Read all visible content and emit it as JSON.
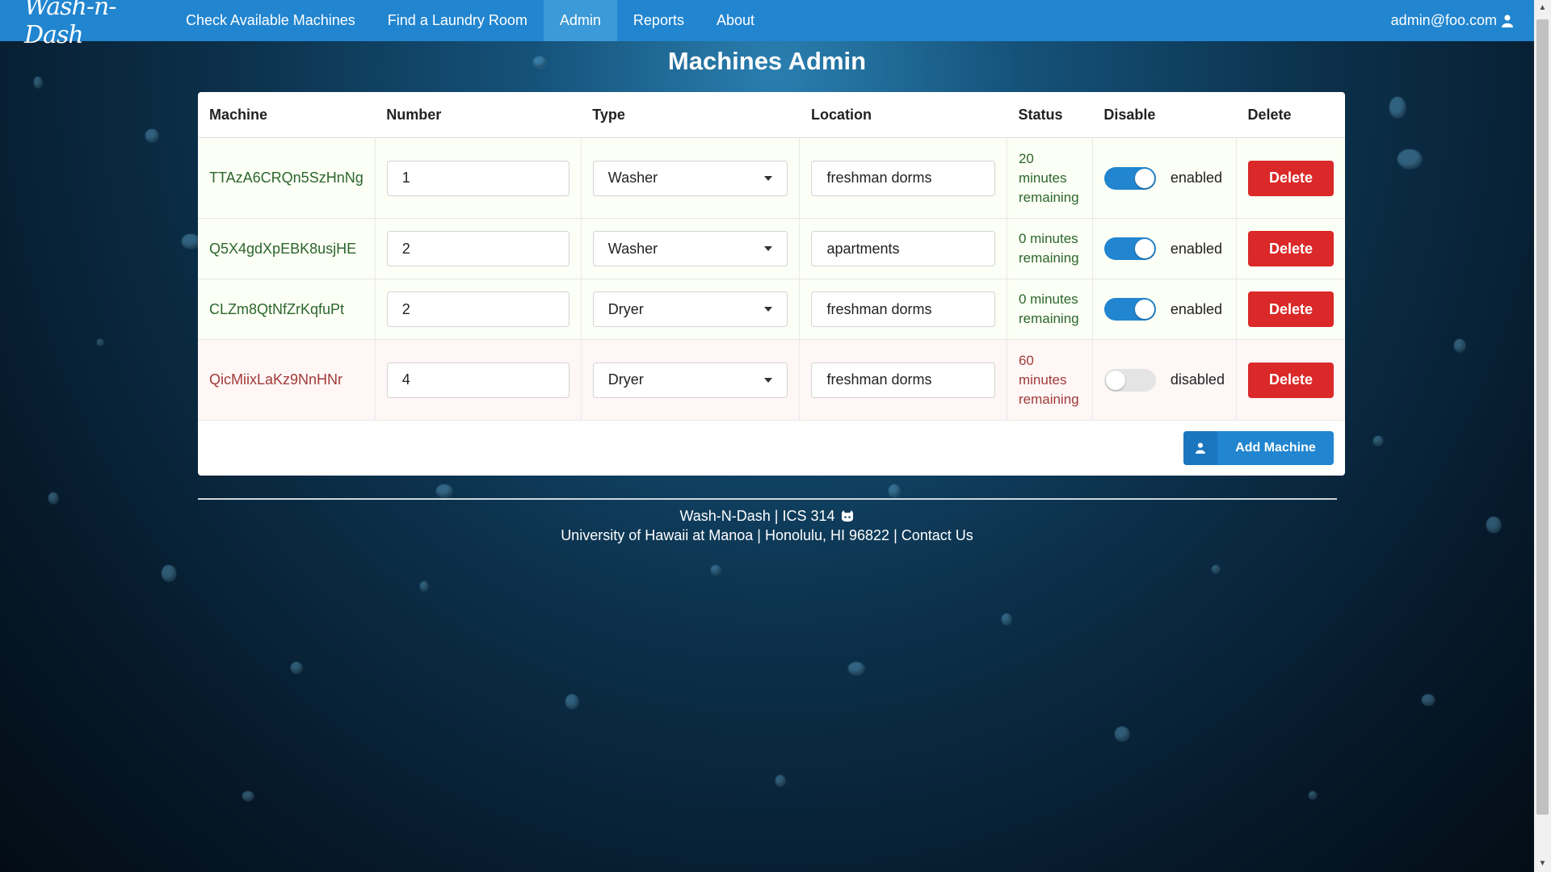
{
  "nav": {
    "logo": "Wash-n-Dash",
    "items": [
      "Check Available Machines",
      "Find a Laundry Room",
      "Admin",
      "Reports",
      "About"
    ],
    "active": "Admin",
    "user": "admin@foo.com"
  },
  "page": {
    "title": "Machines Admin"
  },
  "table": {
    "headers": [
      "Machine",
      "Number",
      "Type",
      "Location",
      "Status",
      "Disable",
      "Delete"
    ],
    "rows": [
      {
        "id": "TTAzA6CRQn5SzHnNg",
        "number": "1",
        "type": "Washer",
        "location": "freshman dorms",
        "status": "20 minutes remaining",
        "toggle": "enabled",
        "delete": "Delete"
      },
      {
        "id": "Q5X4gdXpEBK8usjHE",
        "number": "2",
        "type": "Washer",
        "location": "apartments",
        "status": "0 minutes remaining",
        "toggle": "enabled",
        "delete": "Delete"
      },
      {
        "id": "CLZm8QtNfZrKqfuPt",
        "number": "2",
        "type": "Dryer",
        "location": "freshman dorms",
        "status": "0 minutes remaining",
        "toggle": "enabled",
        "delete": "Delete"
      },
      {
        "id": "QicMiixLaKz9NnHNr",
        "number": "4",
        "type": "Dryer",
        "location": "freshman dorms",
        "status": "60 minutes remaining",
        "toggle": "disabled",
        "delete": "Delete"
      }
    ],
    "add_button": "Add Machine"
  },
  "footer": {
    "line1": "Wash-N-Dash | ICS 314",
    "line2_prefix": "University of Hawaii at Manoa | Honolulu, HI 96822 | ",
    "contact": "Contact Us"
  },
  "colors": {
    "primary": "#2185d0",
    "danger": "#db2828",
    "positive_text": "#2c662d",
    "negative_text": "#9f3a38"
  }
}
